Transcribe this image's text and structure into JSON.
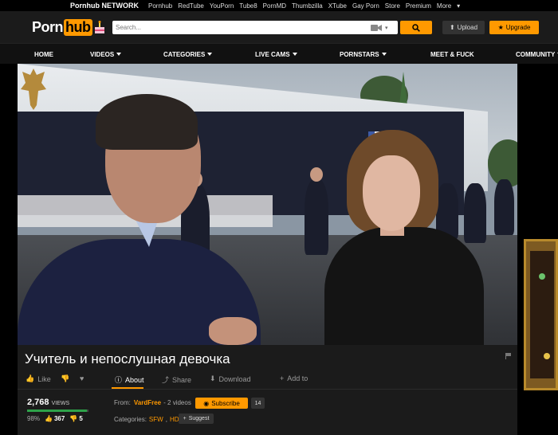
{
  "network": {
    "brand": "Pornhub NETWORK",
    "links": [
      "Pornhub",
      "RedTube",
      "YouPorn",
      "Tube8",
      "PornMD",
      "Thumbzilla",
      "XTube",
      "Gay Porn",
      "Store",
      "Premium",
      "More"
    ]
  },
  "header": {
    "logo_left": "Porn",
    "logo_right": "hub",
    "search_placeholder": "Search...",
    "upload_label": "Upload",
    "upgrade_label": "Upgrade"
  },
  "nav": {
    "items": [
      {
        "label": "HOME",
        "dropdown": false
      },
      {
        "label": "VIDEOS",
        "dropdown": true
      },
      {
        "label": "CATEGORIES",
        "dropdown": true
      },
      {
        "label": "LIVE CAMS",
        "dropdown": true
      },
      {
        "label": "PORNSTARS",
        "dropdown": true
      },
      {
        "label": "MEET & FUCK",
        "dropdown": false
      },
      {
        "label": "COMMUNITY",
        "dropdown": true
      }
    ]
  },
  "video": {
    "title": "Учитель и непослушная девочка",
    "actions": {
      "like": "Like",
      "about": "About",
      "share": "Share",
      "download": "Download",
      "add_to": "Add to"
    },
    "views_count": "2,768",
    "views_label": "VIEWS",
    "rating_percent": "98%",
    "rating_fraction": 0.98,
    "up_votes": "367",
    "down_votes": "5",
    "from_label": "From:",
    "uploader": "VardFree",
    "uploader_videos": "- 2 videos",
    "subscribe_label": "Subscribe",
    "subscriber_count": "14",
    "categories_label": "Categories:",
    "categories": [
      "SFW",
      "HD"
    ],
    "suggest_label": "Suggest"
  },
  "colors": {
    "accent": "#ff9900",
    "rating_bar": "#2ea24a"
  }
}
